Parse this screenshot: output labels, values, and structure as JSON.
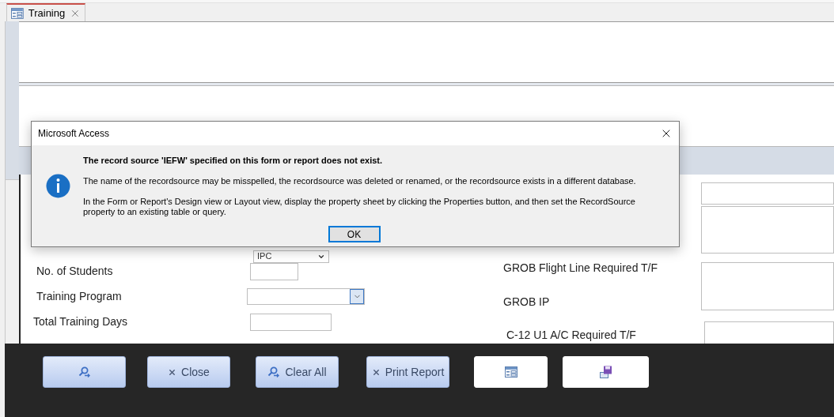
{
  "tab": {
    "title": "Training"
  },
  "form": {
    "combo_top": {
      "value": "IPC"
    },
    "left_fields": [
      {
        "label": "No. of Students",
        "kind": "text"
      },
      {
        "label": "Training Program",
        "kind": "combo"
      },
      {
        "label": "Total Training Days",
        "kind": "text"
      }
    ],
    "right_labels": [
      "GROB Flight Line Required T/F",
      "GROB IP",
      "C-12 U1 A/C Required T/F"
    ]
  },
  "buttons": [
    {
      "kind": "search"
    },
    {
      "kind": "close",
      "label": "Close"
    },
    {
      "kind": "search",
      "label": "Clear All"
    },
    {
      "kind": "close",
      "label": "Print Report"
    },
    {
      "kind": "form"
    },
    {
      "kind": "save"
    }
  ],
  "dialog": {
    "title": "Microsoft Access",
    "heading": "The record source 'IEFW' specified on this form or report does not exist.",
    "paragraphs": [
      "The name of the recordsource may be misspelled, the recordsource was deleted or renamed, or the recordsource exists in a different database.",
      "In the Form or Report's Design view or Layout view, display the property sheet by clicking the Properties button, and then set the RecordSource property to an existing table or query."
    ],
    "ok_button": "OK"
  }
}
